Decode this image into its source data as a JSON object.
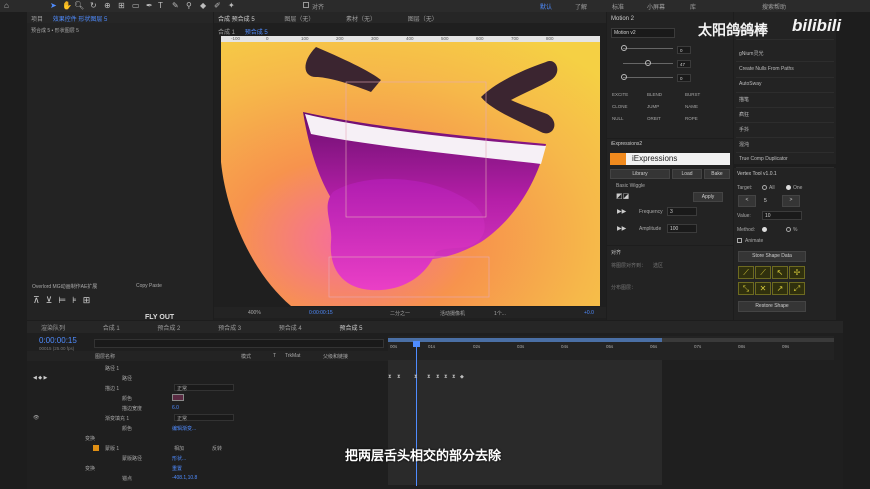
{
  "toolbar": {
    "align_label": "对齐",
    "workspaces": [
      "默认",
      "了解",
      "标准",
      "小屏幕",
      "库"
    ],
    "search_placeholder": "搜索帮助"
  },
  "left_panel": {
    "tabs": [
      "项目",
      "效果控件 形状图层 5"
    ],
    "sub": "预合成 5 • 形状图层 5",
    "bottom_tabs": [
      "Overlord MG动画制作AE扩展",
      "Copy Paste"
    ],
    "canvas_text": "FLY OUT"
  },
  "comp_panel": {
    "tabs": [
      "合成 预合成 5",
      "图层（无）",
      "素材（无）",
      "图层（无）"
    ],
    "sub_tabs": [
      "合成 1",
      "预合成 5"
    ],
    "ruler": [
      "-100",
      "0",
      "100",
      "200",
      "300",
      "400",
      "500",
      "600",
      "700",
      "800",
      "900"
    ],
    "zoom": "400%",
    "timecode": "0:00:00:15",
    "view": "二分之一",
    "camera": "活动摄像机",
    "view_count": "1个...",
    "exposure": "+0.0"
  },
  "motion": {
    "title": "Motion 2",
    "version": "Motion v2",
    "sliders": [
      {
        "value": "0"
      },
      {
        "value": "47"
      },
      {
        "value": "0"
      }
    ],
    "buttons": [
      "EXCITE",
      "BLEND",
      "BURST",
      "CLONE",
      "JUMP",
      "NAME",
      "NULL",
      "ORBIT",
      "ROPE"
    ]
  },
  "iexpr": {
    "title": "iExpressions2",
    "brand": "iExpressions",
    "tabs": [
      "Library",
      "Load",
      "Bake"
    ],
    "section": "Basic Wiggle",
    "apply": "Apply",
    "params": [
      {
        "label": "Frequency",
        "value": "3"
      },
      {
        "label": "Amplitude",
        "value": "100"
      }
    ]
  },
  "align": {
    "title": "对齐",
    "sub": "将图层对齐到：",
    "option": "选区",
    "distribute": "分布图层："
  },
  "right_menu": {
    "items": [
      "Motion 2",
      "gNium灵光",
      "Create Nulls From Paths",
      "AutoSway",
      "描笔",
      "疯狂",
      "手抖",
      "混沌",
      "True Comp Duplicator"
    ]
  },
  "vertex": {
    "title": "Vertex Tool v1.0.1",
    "target_label": "Target:",
    "opt_all": "All",
    "opt_one": "One",
    "stepper_value": "5",
    "value_label": "Value:",
    "value": "10",
    "method_label": "Method:",
    "method_opt": "%",
    "animate_label": "Animate",
    "store": "Store Shape Data",
    "restore": "Restore Shape"
  },
  "timeline": {
    "tabs": [
      "渲染队列",
      "合成 1",
      "预合成 2",
      "预合成 3",
      "预合成 4",
      "预合成 5"
    ],
    "timecode": "0:00:00:15",
    "timecode_sub": "00015 (25.00 fps)",
    "columns": [
      "图层名称",
      "模式",
      "T",
      "TrkMat",
      "父级和链接"
    ],
    "ruler": [
      "00s",
      "01s",
      "02s",
      "03s",
      "04s",
      "05s",
      "06s",
      "07s",
      "08s",
      "09s"
    ],
    "rows": [
      {
        "name": "路径 1",
        "value": ""
      },
      {
        "name": "路径",
        "value": ""
      },
      {
        "name": "描边 1",
        "value": "正常"
      },
      {
        "name": "颜色",
        "value": ""
      },
      {
        "name": "描边宽度",
        "value": "6.0"
      },
      {
        "name": "渐变填充 1",
        "value": "正常"
      },
      {
        "name": "颜色",
        "value": "编辑渐变..."
      },
      {
        "name": "变换",
        "value": ""
      },
      {
        "name": "蒙版 1",
        "value": "相加",
        "extra": "反转"
      },
      {
        "name": "蒙版路径",
        "value": "形状..."
      },
      {
        "name": "变换",
        "value": "重置"
      },
      {
        "name": "锚点",
        "value": "-408.1,10.8"
      }
    ]
  },
  "watermark": {
    "channel": "太阳鸽鸽棒",
    "logo": "bilibili"
  },
  "subtitle": "把两层舌头相交的部分去除"
}
